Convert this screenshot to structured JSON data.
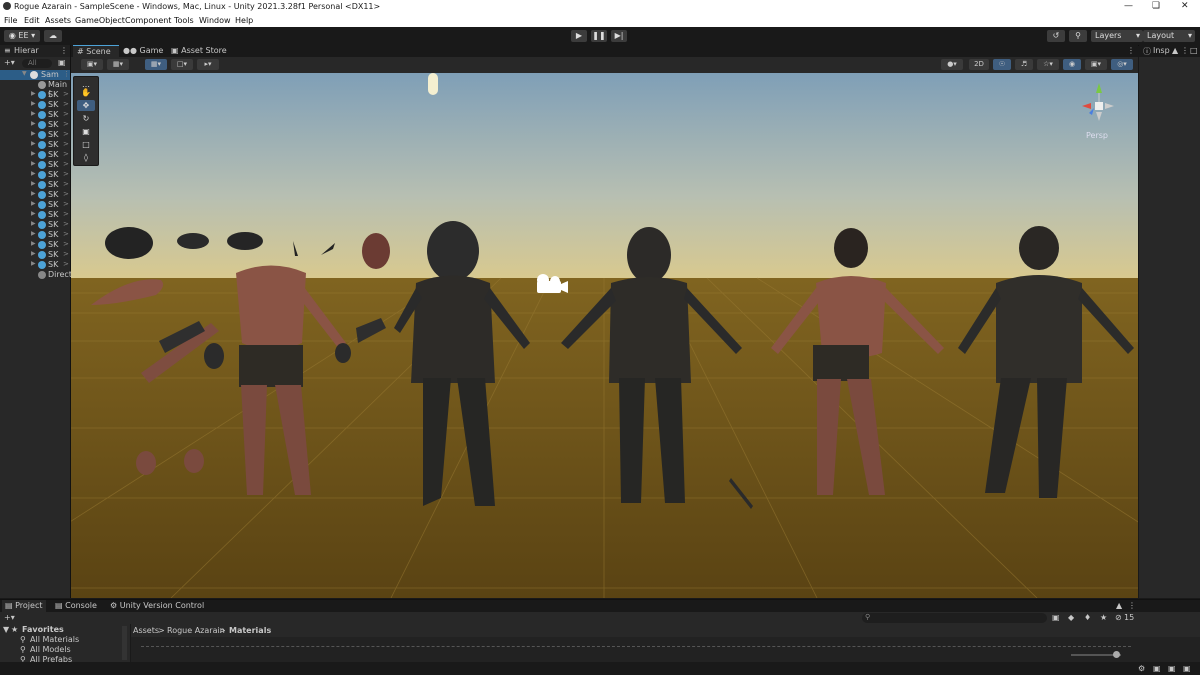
{
  "window": {
    "title": "Rogue Azarain - SampleScene - Windows, Mac, Linux - Unity 2021.3.28f1 Personal <DX11>"
  },
  "menu": [
    "File",
    "Edit",
    "Assets",
    "GameObject",
    "Component",
    "Tools",
    "Window",
    "Help"
  ],
  "toolbar": {
    "account": "EE",
    "layers": "Layers",
    "layout": "Layout"
  },
  "hierarchy": {
    "tab": "Hierar",
    "search_placeholder": "All",
    "scene": "Sam",
    "items": [
      {
        "label": "Main (",
        "type": "camera"
      },
      {
        "label": "SK",
        "type": "prefab"
      },
      {
        "label": "SK",
        "type": "prefab"
      },
      {
        "label": "SK",
        "type": "prefab"
      },
      {
        "label": "SK",
        "type": "prefab"
      },
      {
        "label": "SK",
        "type": "prefab"
      },
      {
        "label": "SK",
        "type": "prefab"
      },
      {
        "label": "SK",
        "type": "prefab"
      },
      {
        "label": "SK",
        "type": "prefab"
      },
      {
        "label": "SK",
        "type": "prefab"
      },
      {
        "label": "SK",
        "type": "prefab"
      },
      {
        "label": "SK",
        "type": "prefab"
      },
      {
        "label": "SK",
        "type": "prefab"
      },
      {
        "label": "SK",
        "type": "prefab"
      },
      {
        "label": "SK",
        "type": "prefab"
      },
      {
        "label": "SK",
        "type": "prefab"
      },
      {
        "label": "SK",
        "type": "prefab"
      },
      {
        "label": "SK",
        "type": "prefab"
      },
      {
        "label": "SK",
        "type": "prefab"
      },
      {
        "label": "Direct",
        "type": "light"
      }
    ]
  },
  "scene_tabs": [
    "Scene",
    "Game",
    "Asset Store"
  ],
  "scene_toolbar": {
    "mode_2d": "2D"
  },
  "gizmo": {
    "label": "Persp"
  },
  "inspector": {
    "tab": "Insp"
  },
  "project": {
    "tabs": [
      "Project",
      "Console",
      "Unity Version Control"
    ],
    "favorites": "Favorites",
    "favorite_items": [
      "All Materials",
      "All Models",
      "All Prefabs"
    ],
    "breadcrumb": [
      "Assets",
      "Rogue Azarain",
      "Materials"
    ],
    "hidden_count": "15"
  },
  "colors": {
    "sky_top": "#7f9fb7",
    "sky_horizon": "#d8c98f",
    "ground": "#6a5217",
    "accent": "#4da3d8"
  }
}
